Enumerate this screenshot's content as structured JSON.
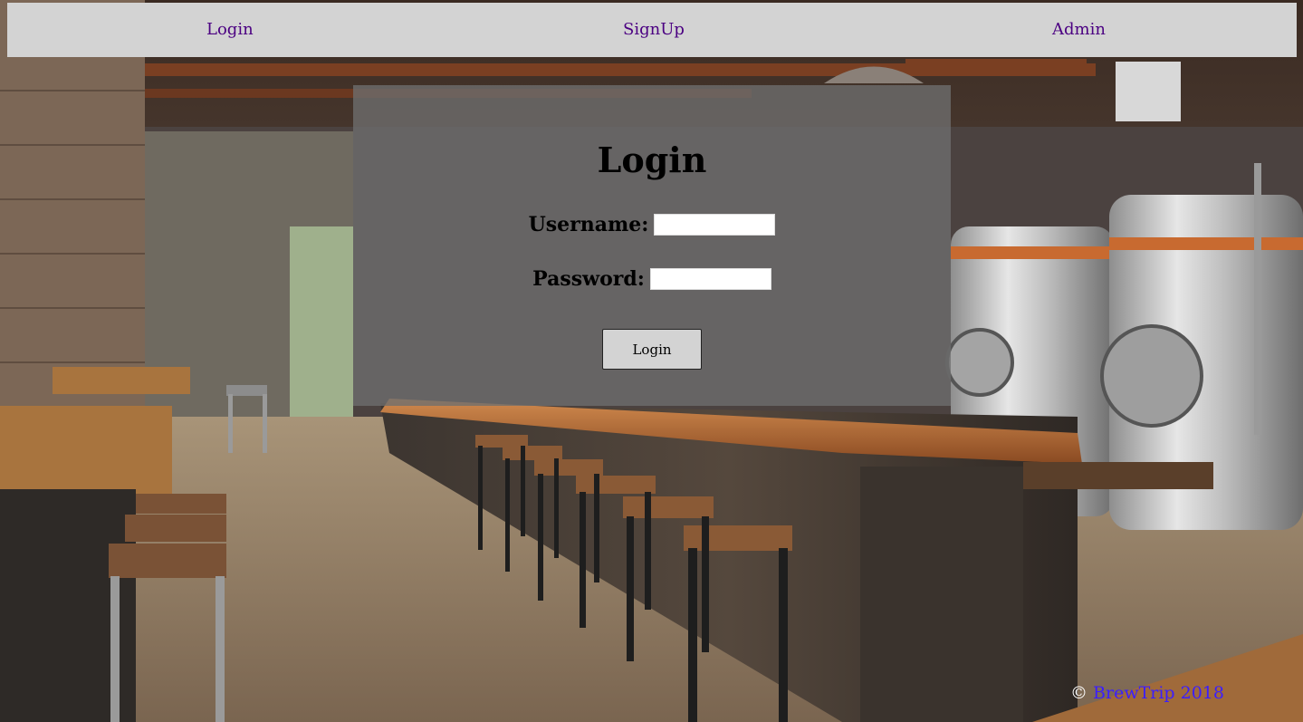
{
  "nav": {
    "login_label": "Login",
    "signup_label": "SignUp",
    "admin_label": "Admin"
  },
  "login_form": {
    "title": "Login",
    "username_label": "Username:",
    "username_value": "",
    "password_label": "Password:",
    "password_value": "",
    "submit_label": "Login"
  },
  "footer": {
    "copyright_symbol": "©",
    "brand_link": "BrewTrip 2018"
  },
  "colors": {
    "nav_background": "#d3d3d3",
    "nav_link": "#4b0082",
    "panel_overlay": "rgba(110,110,110,0.78)",
    "footer_link": "#3b1eff"
  },
  "background_image": "brewery-taproom-interior"
}
